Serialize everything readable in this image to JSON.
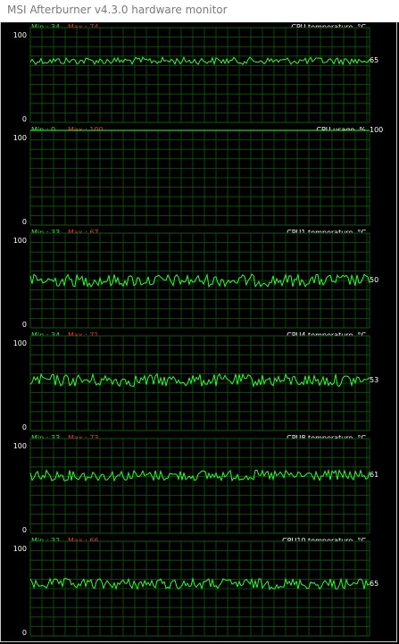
{
  "window": {
    "title": "MSI Afterburner v4.3.0 hardware monitor"
  },
  "colors": {
    "background": "#000000",
    "grid": "#0b5a0b",
    "line": "#2bff2b",
    "min_text": "#33e233",
    "max_text": "#ff2a2a",
    "text": "#ffffff"
  },
  "graphs": [
    {
      "title": "CPU temperature, °C",
      "min_label": "Min : 34",
      "max_label": "Max : 74",
      "y_top": "100",
      "y_bottom": "0",
      "current": "65",
      "level": 65,
      "jitter": 4,
      "flat": false
    },
    {
      "title": "CPU usage, %",
      "min_label": "Min : 0",
      "max_label": "Max : 100",
      "y_top": "100",
      "y_bottom": "0",
      "current": "100",
      "level": 100,
      "jitter": 0,
      "flat": true
    },
    {
      "title": "CPU1 temperature, °C",
      "min_label": "Min : 33",
      "max_label": "Max : 67",
      "y_top": "100",
      "y_bottom": "0",
      "current": "50",
      "level": 50,
      "jitter": 7,
      "flat": false
    },
    {
      "title": "CPU4 temperature, °C",
      "min_label": "Min : 34",
      "max_label": "Max : 71",
      "y_top": "100",
      "y_bottom": "0",
      "current": "53",
      "level": 53,
      "jitter": 7,
      "flat": false
    },
    {
      "title": "CPU8 temperature, °C",
      "min_label": "Min : 33",
      "max_label": "Max : 73",
      "y_top": "100",
      "y_bottom": "0",
      "current": "61",
      "level": 61,
      "jitter": 6,
      "flat": false
    },
    {
      "title": "CPU10 temperature, °C",
      "min_label": "Min : 32",
      "max_label": "Max : 66",
      "y_top": "100",
      "y_bottom": "0",
      "current": "65",
      "level": 55,
      "jitter": 6,
      "flat": false
    }
  ]
}
